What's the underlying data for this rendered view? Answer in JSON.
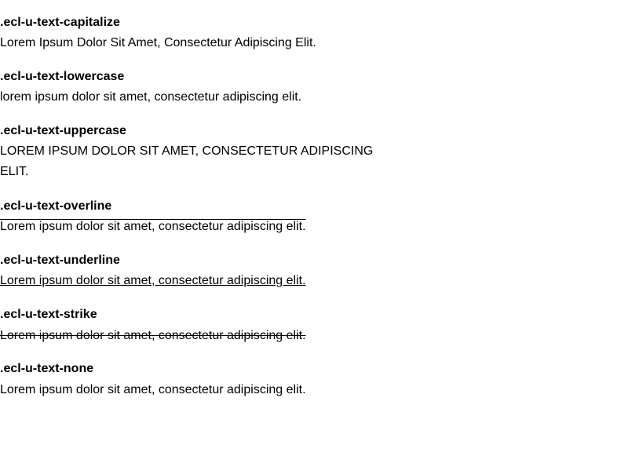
{
  "examples": [
    {
      "class_name": ".ecl-u-text-capitalize",
      "sample": "Lorem ipsum dolor sit amet, consectetur adipiscing elit."
    },
    {
      "class_name": ".ecl-u-text-lowercase",
      "sample": "Lorem ipsum dolor sit amet, consectetur adipiscing elit."
    },
    {
      "class_name": ".ecl-u-text-uppercase",
      "sample": "Lorem ipsum dolor sit amet, consectetur adipiscing elit."
    },
    {
      "class_name": ".ecl-u-text-overline",
      "sample": "Lorem ipsum dolor sit amet, consectetur adipiscing elit."
    },
    {
      "class_name": ".ecl-u-text-underline",
      "sample": "Lorem ipsum dolor sit amet, consectetur adipiscing elit."
    },
    {
      "class_name": ".ecl-u-text-strike",
      "sample": "Lorem ipsum dolor sit amet, consectetur adipiscing elit."
    },
    {
      "class_name": ".ecl-u-text-none",
      "sample": "Lorem ipsum dolor sit amet, consectetur adipiscing elit."
    }
  ]
}
